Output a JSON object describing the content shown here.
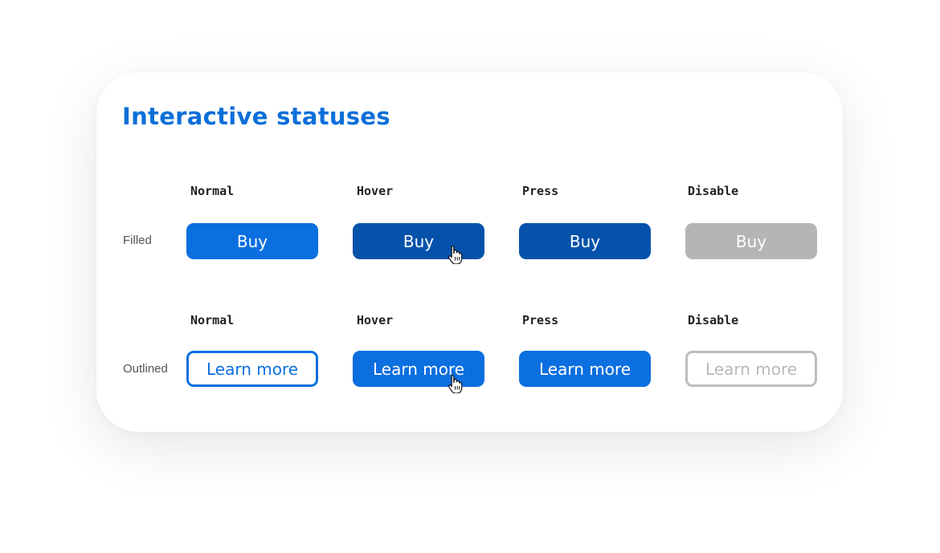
{
  "title": "Interactive statuses",
  "colors": {
    "accent": "#0b6fdf",
    "accent_dark": "#0552ab",
    "disabled": "#b5b5b5"
  },
  "rows": {
    "filled": {
      "label": "Filled",
      "columns": [
        "Normal",
        "Hover",
        "Press",
        "Disable"
      ],
      "button_label": "Buy"
    },
    "outlined": {
      "label": "Outlined",
      "columns": [
        "Normal",
        "Hover",
        "Press",
        "Disable"
      ],
      "button_label": "Learn more"
    }
  },
  "cursor_icon": "hand-pointer-icon"
}
